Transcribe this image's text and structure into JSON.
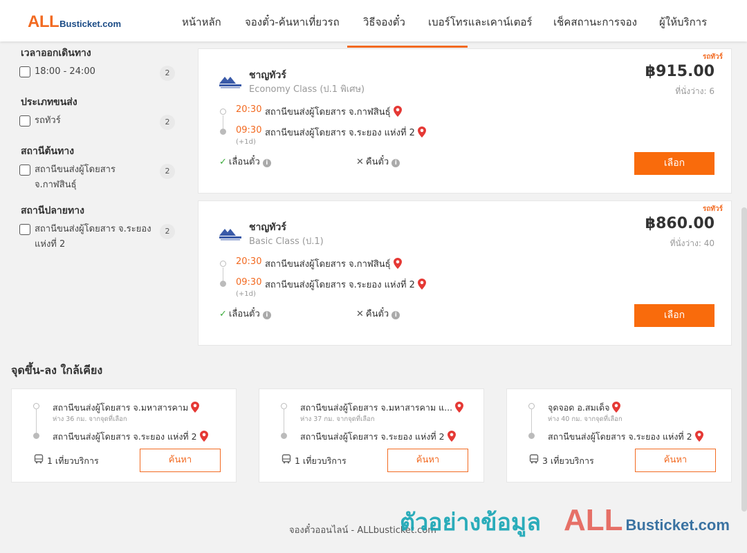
{
  "header": {
    "logo_all": "ALL",
    "logo_rest": "Busticket.com",
    "nav": [
      "หน้าหลัก",
      "จองตั๋ว-ค้นหาเที่ยวรถ",
      "วิธีจองตั๋ว",
      "เบอร์โทรและเคาน์เตอร์",
      "เช็คสถานะการจอง",
      "ผู้ให้บริการ"
    ]
  },
  "filters": {
    "departure_time": {
      "title": "เวลาออกเดินทาง",
      "option": "18:00 - 24:00",
      "count": "2"
    },
    "transport_type": {
      "title": "ประเภทขนส่ง",
      "option": "รถทัวร์",
      "count": "2"
    },
    "origin": {
      "title": "สถานีต้นทาง",
      "option_line1": "สถานีขนส่งผู้โดยสาร",
      "option_line2": "จ.กาฬสินธุ์",
      "count": "2"
    },
    "destination": {
      "title": "สถานีปลายทาง",
      "option_line1": "สถานีขนส่งผู้โดยสาร จ.ระยอง",
      "option_line2": "แห่งที่ 2",
      "count": "2"
    }
  },
  "trips": [
    {
      "tag": "รถทัวร์",
      "operator": "ชาญทัวร์",
      "class": "Economy Class (ป.1 พิเศษ)",
      "price": "฿915.00",
      "seats": "ที่นั่งว่าง: 6",
      "dep_time": "20:30",
      "dep_stop": "สถานีขนส่งผู้โดยสาร จ.กาฬสินธุ์",
      "arr_time": "09:30",
      "arr_stop": "สถานีขนส่งผู้โดยสาร จ.ระยอง แห่งที่ 2",
      "next_day": "(+1d)",
      "policy_change": "เลื่อนตั๋ว",
      "policy_refund": "คืนตั๋ว",
      "select": "เลือก"
    },
    {
      "tag": "รถทัวร์",
      "operator": "ชาญทัวร์",
      "class": "Basic Class (ป.1)",
      "price": "฿860.00",
      "seats": "ที่นั่งว่าง: 40",
      "dep_time": "20:30",
      "dep_stop": "สถานีขนส่งผู้โดยสาร จ.กาฬสินธุ์",
      "arr_time": "09:30",
      "arr_stop": "สถานีขนส่งผู้โดยสาร จ.ระยอง แห่งที่ 2",
      "next_day": "(+1d)",
      "policy_change": "เลื่อนตั๋ว",
      "policy_refund": "คืนตั๋ว",
      "select": "เลือก"
    }
  ],
  "nearby": {
    "title": "จุดขึ้น-ลง ใกล้เคียง",
    "items": [
      {
        "from": "สถานีขนส่งผู้โดยสาร จ.มหาสารคาม",
        "distance": "ห่าง 36 กม. จากจุดที่เลือก",
        "to": "สถานีขนส่งผู้โดยสาร จ.ระยอง แห่งที่ 2",
        "trips": "1 เที่ยวบริการ",
        "search": "ค้นหา"
      },
      {
        "from": "สถานีขนส่งผู้โดยสาร จ.มหาสารคาม แ...",
        "distance": "ห่าง 37 กม. จากจุดที่เลือก",
        "to": "สถานีขนส่งผู้โดยสาร จ.ระยอง แห่งที่ 2",
        "trips": "1 เที่ยวบริการ",
        "search": "ค้นหา"
      },
      {
        "from": "จุดจอด อ.สมเด็จ",
        "distance": "ห่าง 40 กม. จากจุดที่เลือก",
        "to": "สถานีขนส่งผู้โดยสาร จ.ระยอง แห่งที่ 2",
        "trips": "3 เที่ยวบริการ",
        "search": "ค้นหา"
      }
    ]
  },
  "footer": {
    "text": "จองตั๋วออนไลน์ - ALLbusticket.com",
    "watermark": "ตัวอย่างข้อมูล",
    "wm_all": "ALL",
    "wm_rest": "Busticket.com"
  }
}
